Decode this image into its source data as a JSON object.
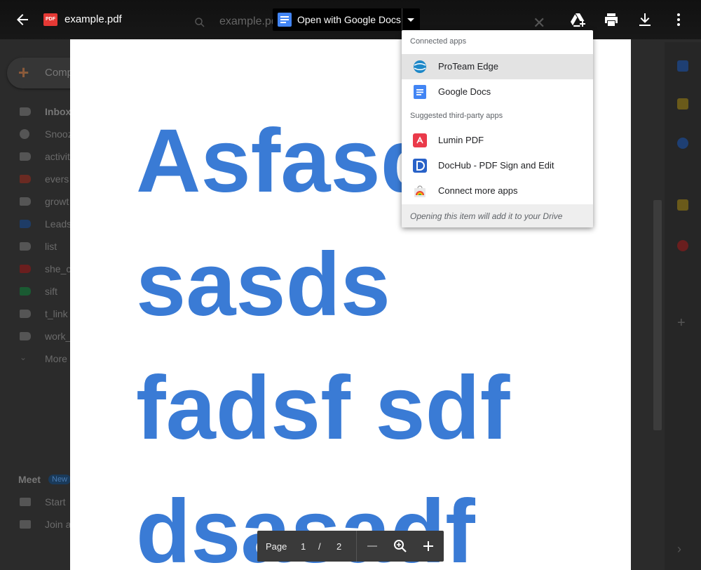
{
  "background": {
    "compose_label": "Comp",
    "nav": [
      {
        "label": "Inbox",
        "bold": true
      },
      {
        "label": "Snooz"
      },
      {
        "label": "activit"
      },
      {
        "label": "evers"
      },
      {
        "label": "growt"
      },
      {
        "label": "Leads"
      },
      {
        "label": "list"
      },
      {
        "label": "she_c"
      },
      {
        "label": "sift"
      },
      {
        "label": "t_link"
      },
      {
        "label": "work_"
      },
      {
        "label": "More"
      }
    ],
    "meet_title": "Meet",
    "meet_badge": "New",
    "meet_items": [
      "Start",
      "Join a"
    ]
  },
  "topbar": {
    "file_name": "example.pdf",
    "pdf_badge": "PDF",
    "search_ghost": "example.pd",
    "open_with_label": "Open with Google Docs"
  },
  "pdf": {
    "lines": [
      "Asfasd",
      "sasds",
      "fadsf sdf",
      "dsasadf"
    ]
  },
  "menu": {
    "connected_header": "Connected apps",
    "connected": [
      "ProTeam Edge",
      "Google Docs"
    ],
    "suggested_header": "Suggested third-party apps",
    "suggested": [
      "Lumin PDF",
      "DocHub - PDF Sign and Edit",
      "Connect more apps"
    ],
    "footer": "Opening this item will add it to your Drive"
  },
  "pager": {
    "label": "Page",
    "current": "1",
    "separator": "/",
    "total": "2"
  },
  "colors": {
    "pdf_text": "#3a7bd5",
    "menu_active": "#e3e3e3",
    "accent_red": "#e53935"
  }
}
